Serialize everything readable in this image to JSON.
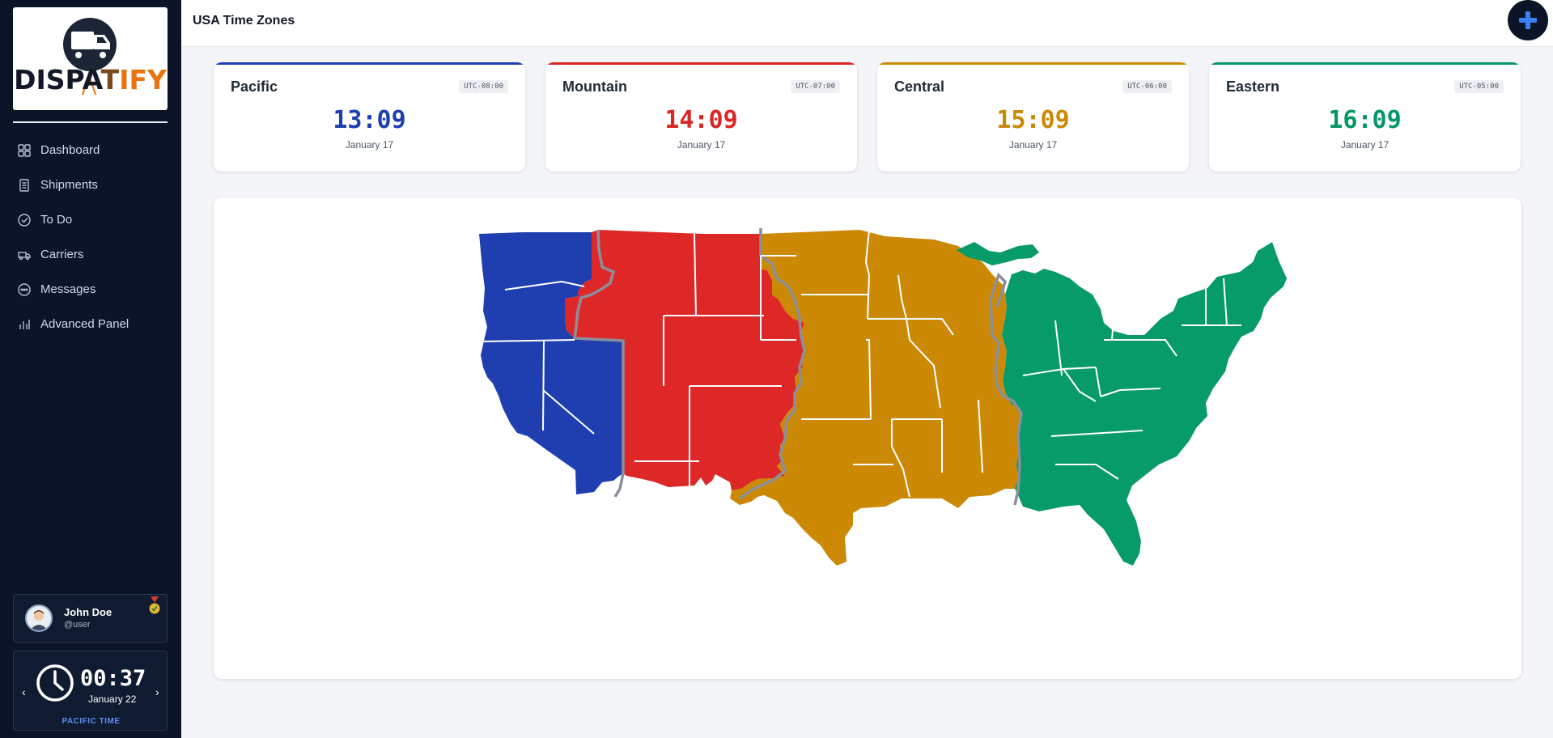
{
  "brand": {
    "name_part1": "DISPA",
    "name_part2": "T",
    "name_part3": "IFY"
  },
  "sidebar": {
    "items": [
      {
        "label": "Dashboard",
        "icon": "dashboard-icon"
      },
      {
        "label": "Shipments",
        "icon": "document-icon"
      },
      {
        "label": "To Do",
        "icon": "check-circle-icon"
      },
      {
        "label": "Carriers",
        "icon": "truck-icon"
      },
      {
        "label": "Messages",
        "icon": "chat-icon"
      },
      {
        "label": "Advanced Panel",
        "icon": "bar-chart-icon"
      }
    ]
  },
  "user": {
    "name": "John Doe",
    "handle": "@user"
  },
  "clock": {
    "time": "00:37",
    "date": "January 22",
    "zone_label": "PACIFIC TIME",
    "prev": "‹",
    "next": "›"
  },
  "header": {
    "title": "USA Time Zones"
  },
  "zones": [
    {
      "name": "Pacific",
      "offset": "UTC-08:00",
      "time": "13:09",
      "date": "January 17",
      "color": "#1e40af"
    },
    {
      "name": "Mountain",
      "offset": "UTC-07:00",
      "time": "14:09",
      "date": "January 17",
      "color": "#dc2626"
    },
    {
      "name": "Central",
      "offset": "UTC-06:00",
      "time": "15:09",
      "date": "January 17",
      "color": "#ca8a04"
    },
    {
      "name": "Eastern",
      "offset": "UTC-05:00",
      "time": "16:09",
      "date": "January 17",
      "color": "#059669"
    }
  ],
  "map_colors": {
    "pacific": "#1f3fb0",
    "mountain": "#de2828",
    "central": "#cb8905",
    "eastern": "#079b6a",
    "border": "#8b8f9a"
  }
}
